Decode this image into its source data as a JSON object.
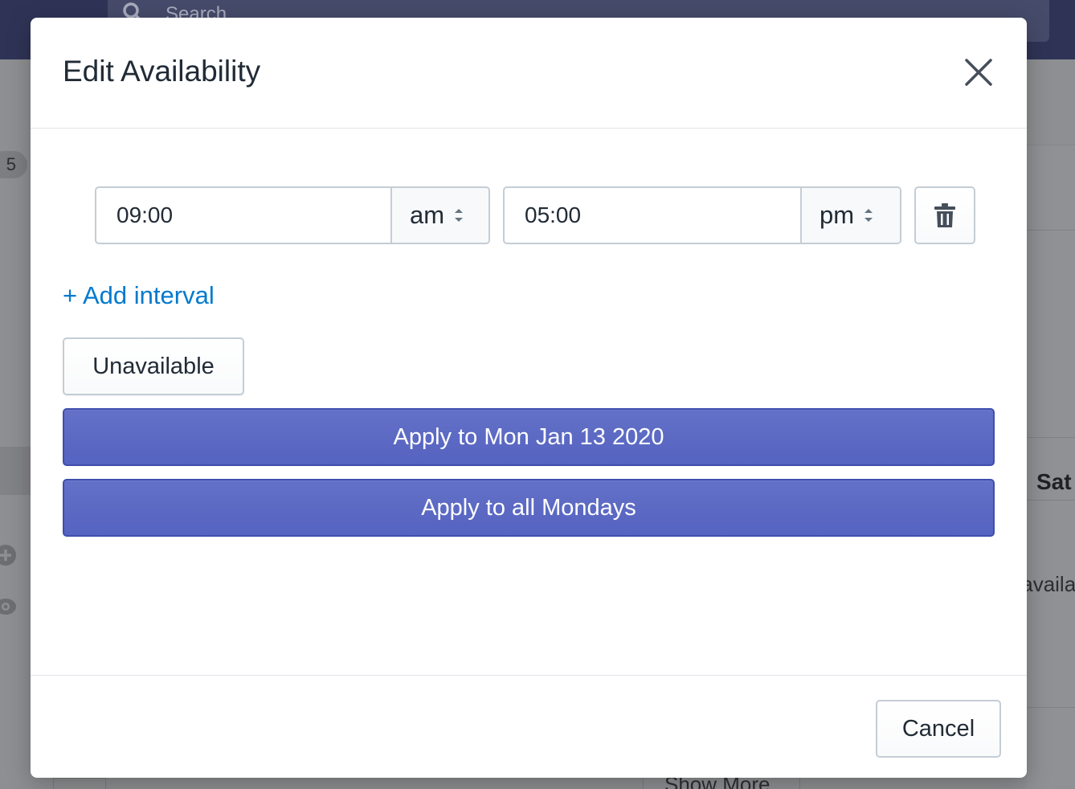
{
  "background": {
    "search_placeholder": "Search",
    "sidebar_badge": "5",
    "column_header": "Sat",
    "cell_text": "Unavailable",
    "show_more_label": "Show More"
  },
  "modal": {
    "title": "Edit Availability",
    "close_icon": "close-x-icon",
    "interval": {
      "start_time": "09:00",
      "start_period": "am",
      "end_time": "05:00",
      "end_period": "pm",
      "delete_icon": "trash-icon"
    },
    "add_interval_label": "+ Add interval",
    "unavailable_label": "Unavailable",
    "apply_date_label": "Apply to Mon Jan 13 2020",
    "apply_all_label": "Apply to all Mondays",
    "cancel_label": "Cancel"
  },
  "colors": {
    "primary": "#5c6ac4",
    "link": "#007ace",
    "border": "#c4cdd5",
    "overlay": "#8d8e91"
  }
}
